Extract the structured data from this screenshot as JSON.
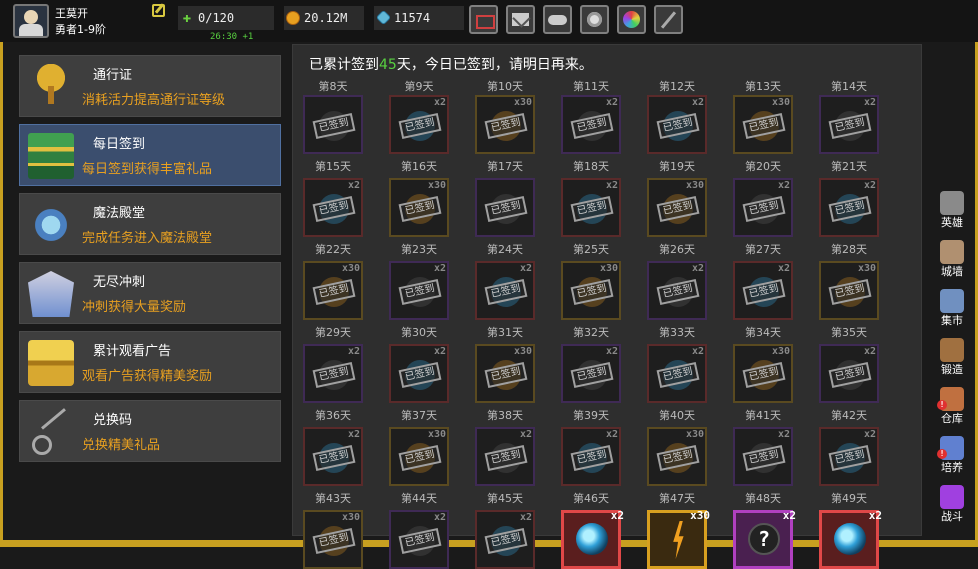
{
  "player": {
    "name": "王莫开",
    "rank": "勇者1-9阶"
  },
  "stats": {
    "stamina": "0/120",
    "stamina_timer": "26:30 +1",
    "gold": "20.12M",
    "gems": "11574"
  },
  "menu": [
    {
      "title": "通行证",
      "desc": "消耗活力提高通行证等级"
    },
    {
      "title": "每日签到",
      "desc": "每日签到获得丰富礼品"
    },
    {
      "title": "魔法殿堂",
      "desc": "完成任务进入魔法殿堂"
    },
    {
      "title": "无尽冲刺",
      "desc": "冲刺获得大量奖励"
    },
    {
      "title": "累计观看广告",
      "desc": "观看广告获得精美奖励"
    },
    {
      "title": "兑换码",
      "desc": "兑换精美礼品"
    }
  ],
  "signin": {
    "prefix": "已累计签到",
    "count": "45",
    "suffix": "天，今日已签到，请明日再来。",
    "stamp": "已签到"
  },
  "days": [
    {
      "day": "第8天",
      "color": "purple",
      "count": ""
    },
    {
      "day": "第9天",
      "color": "red",
      "count": "x2"
    },
    {
      "day": "第10天",
      "color": "gold",
      "count": "x30"
    },
    {
      "day": "第11天",
      "color": "purple",
      "count": "x2"
    },
    {
      "day": "第12天",
      "color": "red",
      "count": "x2"
    },
    {
      "day": "第13天",
      "color": "gold",
      "count": "x30"
    },
    {
      "day": "第14天",
      "color": "purple",
      "count": "x2"
    },
    {
      "day": "第15天",
      "color": "red",
      "count": "x2"
    },
    {
      "day": "第16天",
      "color": "gold",
      "count": "x30"
    },
    {
      "day": "第17天",
      "color": "purple",
      "count": ""
    },
    {
      "day": "第18天",
      "color": "red",
      "count": "x2"
    },
    {
      "day": "第19天",
      "color": "gold",
      "count": "x30"
    },
    {
      "day": "第20天",
      "color": "purple",
      "count": "x2"
    },
    {
      "day": "第21天",
      "color": "red",
      "count": "x2"
    },
    {
      "day": "第22天",
      "color": "gold",
      "count": "x30"
    },
    {
      "day": "第23天",
      "color": "purple",
      "count": "x2"
    },
    {
      "day": "第24天",
      "color": "red",
      "count": "x2"
    },
    {
      "day": "第25天",
      "color": "gold",
      "count": "x30"
    },
    {
      "day": "第26天",
      "color": "purple",
      "count": "x2"
    },
    {
      "day": "第27天",
      "color": "red",
      "count": "x2"
    },
    {
      "day": "第28天",
      "color": "gold",
      "count": "x30"
    },
    {
      "day": "第29天",
      "color": "purple",
      "count": "x2"
    },
    {
      "day": "第30天",
      "color": "red",
      "count": "x2"
    },
    {
      "day": "第31天",
      "color": "gold",
      "count": "x30"
    },
    {
      "day": "第32天",
      "color": "purple",
      "count": "x2"
    },
    {
      "day": "第33天",
      "color": "red",
      "count": "x2"
    },
    {
      "day": "第34天",
      "color": "gold",
      "count": "x30"
    },
    {
      "day": "第35天",
      "color": "purple",
      "count": "x2"
    },
    {
      "day": "第36天",
      "color": "red",
      "count": "x2"
    },
    {
      "day": "第37天",
      "color": "gold",
      "count": "x30"
    },
    {
      "day": "第38天",
      "color": "purple",
      "count": "x2"
    },
    {
      "day": "第39天",
      "color": "red",
      "count": "x2"
    },
    {
      "day": "第40天",
      "color": "gold",
      "count": "x30"
    },
    {
      "day": "第41天",
      "color": "purple",
      "count": "x2"
    },
    {
      "day": "第42天",
      "color": "red",
      "count": "x2"
    },
    {
      "day": "第43天",
      "color": "gold",
      "count": "x30"
    },
    {
      "day": "第44天",
      "color": "purple",
      "count": "x2"
    },
    {
      "day": "第45天",
      "color": "red",
      "count": "x2"
    },
    {
      "day": "第46天",
      "color": "red",
      "count": "x2",
      "item": "orb"
    },
    {
      "day": "第47天",
      "color": "gold",
      "count": "x30",
      "item": "bolt"
    },
    {
      "day": "第48天",
      "color": "purple",
      "count": "x2",
      "item": "qmark",
      "qmark": "?"
    },
    {
      "day": "第49天",
      "color": "red",
      "count": "x2",
      "item": "orb"
    }
  ],
  "rightbar": [
    {
      "label": "英雄",
      "icon": "hero-icon",
      "color": "#8a8a8a",
      "alert": false
    },
    {
      "label": "城墙",
      "icon": "wall-icon",
      "color": "#b09070",
      "alert": false
    },
    {
      "label": "集市",
      "icon": "market-icon",
      "color": "#7090c0",
      "alert": false
    },
    {
      "label": "锻造",
      "icon": "anvil-icon",
      "color": "#a07040",
      "alert": false
    },
    {
      "label": "仓库",
      "icon": "warehouse-icon",
      "color": "#c07040",
      "alert": true
    },
    {
      "label": "培养",
      "icon": "train-icon",
      "color": "#6080d0",
      "alert": true
    },
    {
      "label": "战斗",
      "icon": "battle-icon",
      "color": "#a040e0",
      "alert": false
    }
  ],
  "alert_mark": "!"
}
